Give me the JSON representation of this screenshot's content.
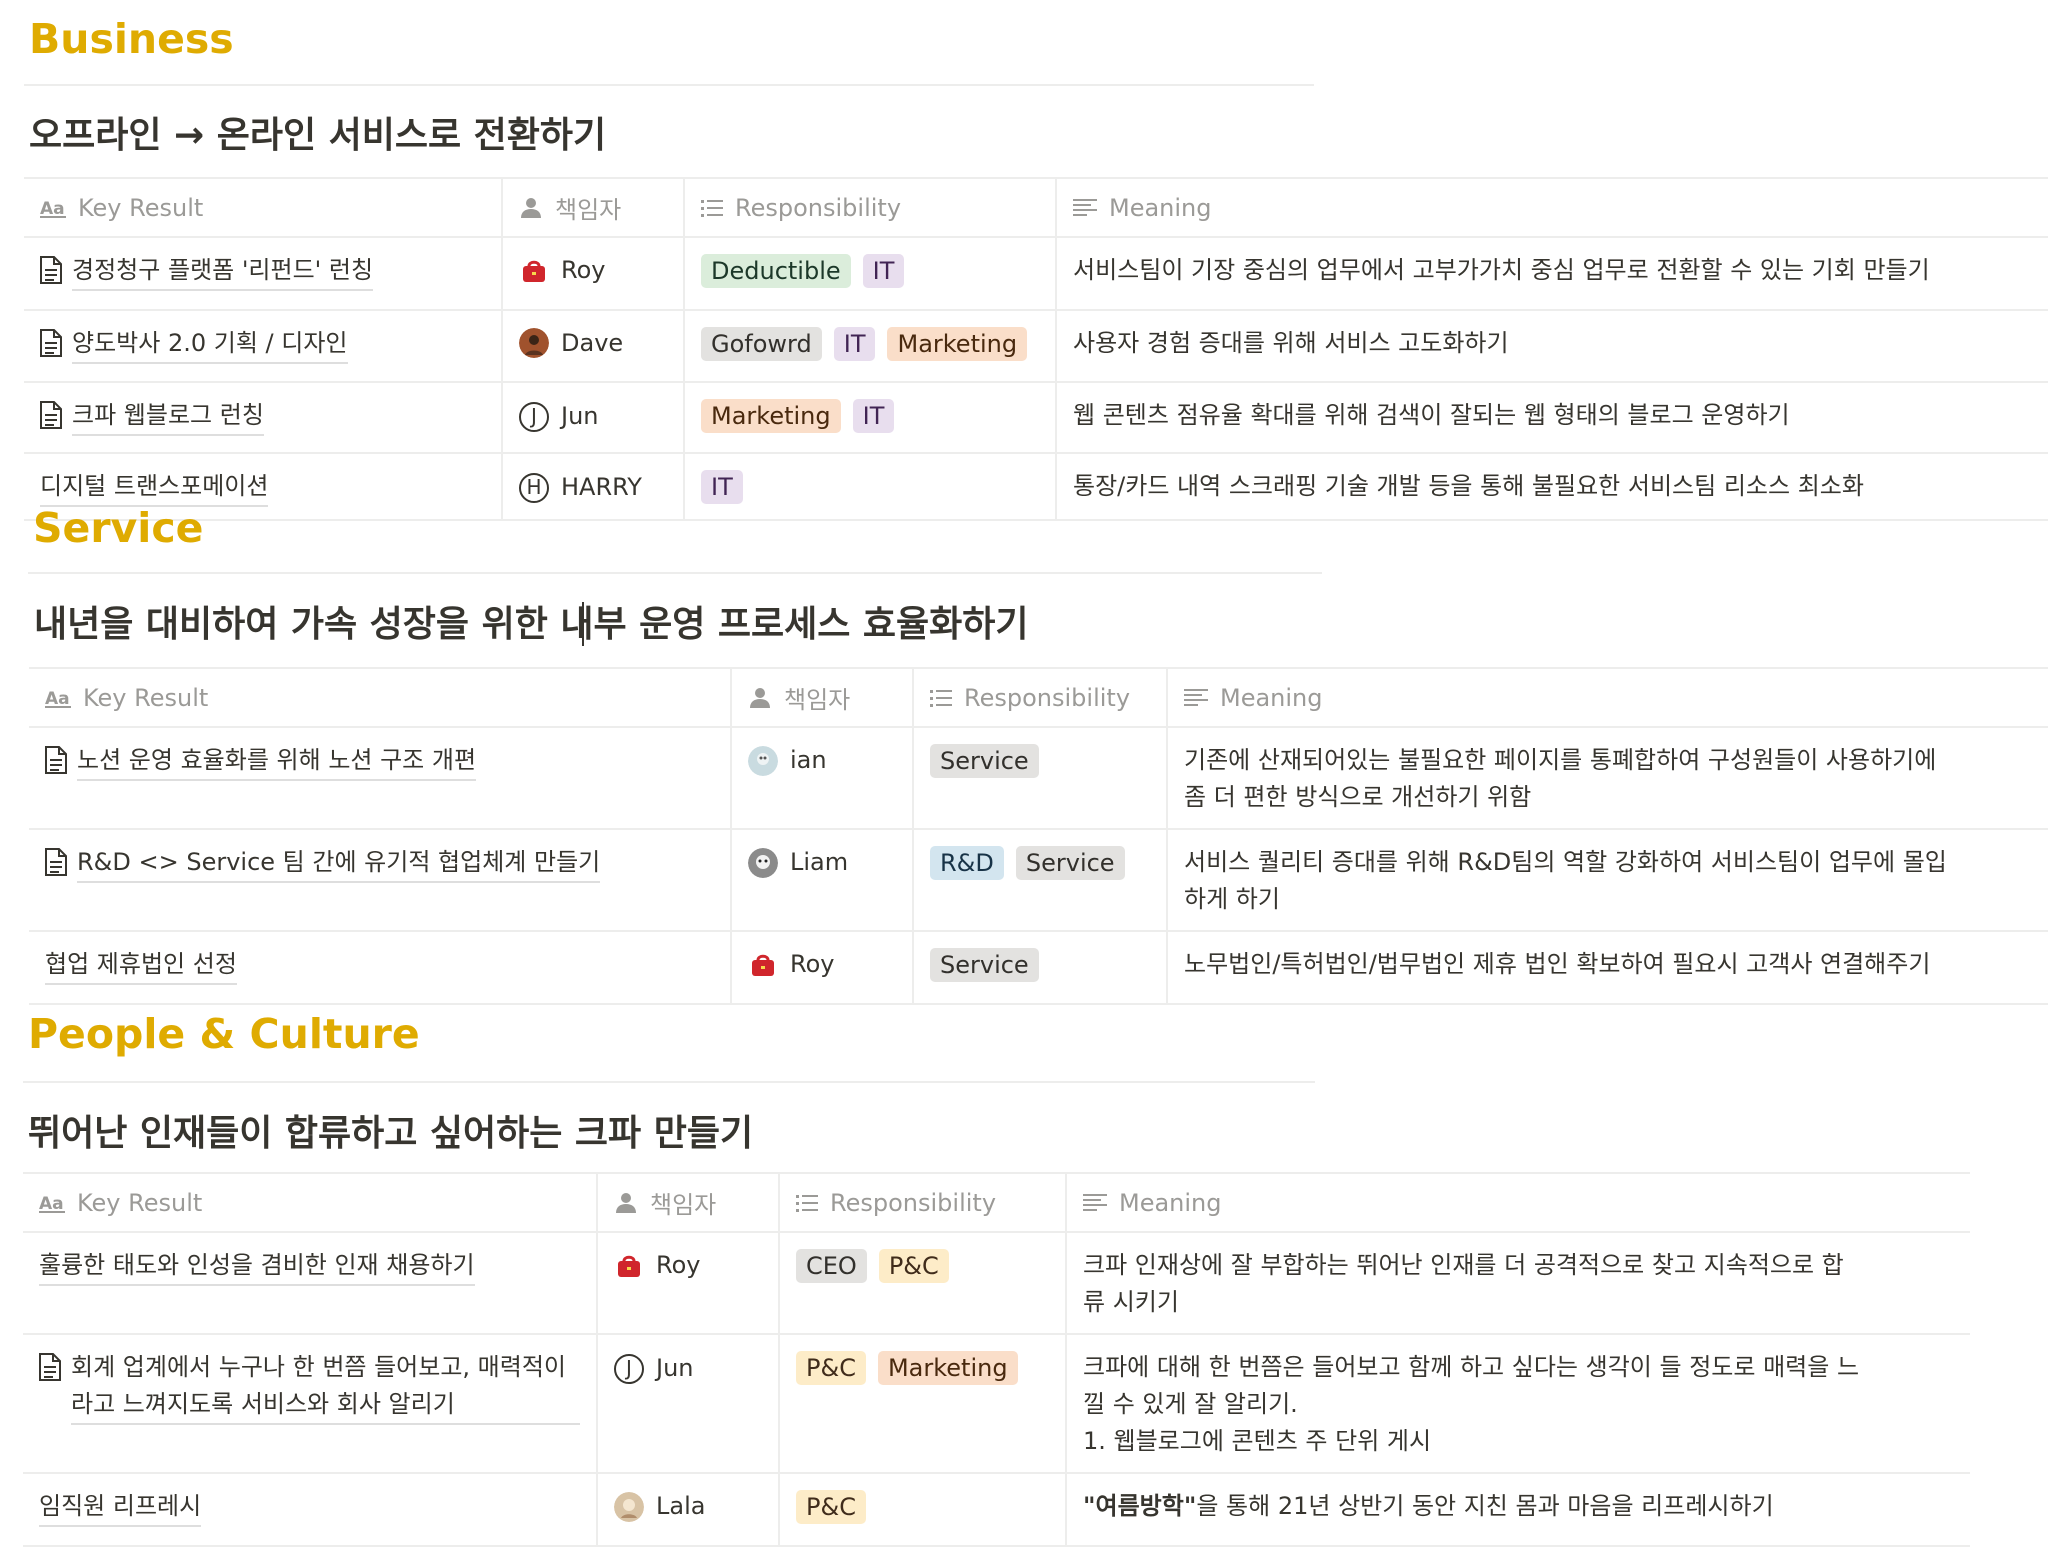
{
  "sections": [
    {
      "title": "Business",
      "objective": "오프라인 → 온라인 서비스로 전환하기",
      "columns": {
        "key_result": "Key Result",
        "owner": "책임자",
        "responsibility": "Responsibility",
        "meaning": "Meaning"
      },
      "rows": [
        {
          "key_result": "경정청구 플랫폼 '리펀드' 런칭",
          "page_icon": true,
          "owner": "Roy",
          "avatar": "red-bag-avatar",
          "tags": [
            "Deductible",
            "IT"
          ],
          "meaning": [
            "서비스팀이 기장 중심의 업무에서 고부가가치 중심 업무로 전환할 수 있는 기회 만들기"
          ]
        },
        {
          "key_result": "양도박사 2.0 기획 / 디자인",
          "page_icon": true,
          "owner": "Dave",
          "avatar": "photo-avatar-dave",
          "tags": [
            "Gofowrd",
            "IT",
            "Marketing"
          ],
          "meaning": [
            "사용자 경험 증대를 위해 서비스 고도화하기"
          ]
        },
        {
          "key_result": "크파 웹블로그 런칭",
          "page_icon": true,
          "owner": "Jun",
          "avatar": "J",
          "tags": [
            "Marketing",
            "IT"
          ],
          "meaning": [
            "웹 콘텐츠 점유율 확대를 위해 검색이 잘되는 웹 형태의 블로그 운영하기"
          ]
        },
        {
          "key_result": "디지털 트랜스포메이션",
          "page_icon": false,
          "owner": "HARRY",
          "avatar": "H",
          "tags": [
            "IT"
          ],
          "meaning": [
            "통장/카드 내역 스크래핑 기술 개발 등을 통해 불필요한 서비스팀 리소스 최소화"
          ]
        }
      ]
    },
    {
      "title": "Service",
      "objective": "내년을 대비하여 가속 성장을 위한 내부 운영 프로세스 효율화하기",
      "columns": {
        "key_result": "Key Result",
        "owner": "책임자",
        "responsibility": "Responsibility",
        "meaning": "Meaning"
      },
      "rows": [
        {
          "key_result": "노션 운영 효율화를 위해 노션 구조 개편",
          "page_icon": true,
          "owner": "ian",
          "avatar": "photo-avatar-ian",
          "tags": [
            "Service"
          ],
          "meaning": [
            "기존에 산재되어있는 불필요한 페이지를 통폐합하여 구성원들이 사용하기에",
            "좀 더 편한 방식으로 개선하기 위함"
          ]
        },
        {
          "key_result": "R&D <> Service 팀 간에 유기적 협업체계 만들기",
          "page_icon": true,
          "owner": "Liam",
          "avatar": "photo-avatar-liam",
          "tags": [
            "R&D",
            "Service"
          ],
          "meaning": [
            "서비스 퀄리티 증대를 위해 R&D팀의 역할 강화하여 서비스팀이 업무에 몰입",
            "하게 하기"
          ]
        },
        {
          "key_result": "협업 제휴법인 선정",
          "page_icon": false,
          "owner": "Roy",
          "avatar": "red-bag-avatar",
          "tags": [
            "Service"
          ],
          "meaning": [
            "노무법인/특허법인/법무법인 제휴 법인 확보하여 필요시 고객사 연결해주기"
          ]
        }
      ]
    },
    {
      "title": "People & Culture",
      "objective": "뛰어난 인재들이 합류하고 싶어하는 크파 만들기",
      "columns": {
        "key_result": "Key Result",
        "owner": "책임자",
        "responsibility": "Responsibility",
        "meaning": "Meaning"
      },
      "rows": [
        {
          "key_result": "훌륭한 태도와 인성을 겸비한 인재 채용하기",
          "page_icon": false,
          "owner": "Roy",
          "avatar": "red-bag-avatar",
          "tags": [
            "CEO",
            "P&C"
          ],
          "meaning": [
            "크파 인재상에 잘 부합하는 뛰어난 인재를 더 공격적으로 찾고 지속적으로 합",
            "류 시키기"
          ]
        },
        {
          "key_result": "회계 업계에서 누구나 한 번쯤 들어보고, 매력적이라고 느껴지도록 서비스와 회사 알리기",
          "page_icon": true,
          "owner": "Jun",
          "avatar": "J",
          "tags": [
            "P&C",
            "Marketing"
          ],
          "meaning": [
            "크파에 대해 한 번쯤은 들어보고 함께 하고 싶다는 생각이 들 정도로 매력을 느",
            "낄 수 있게 잘 알리기.",
            "1. 웹블로그에 콘텐츠 주 단위 게시"
          ]
        },
        {
          "key_result": "임직원 리프레시",
          "page_icon": false,
          "owner": "Lala",
          "avatar": "photo-avatar-lala",
          "tags": [
            "P&C"
          ],
          "meaning_bold": "\"여름방학\"",
          "meaning": [
            "을 통해 21년 상반기 동안 지친 몸과 마음을 리프레시하기"
          ]
        }
      ]
    }
  ],
  "colors": {
    "section_title": "#dfab01",
    "text": "#37352f",
    "header_text": "#9b9a97",
    "border": "#ededec"
  },
  "icons": {
    "key_result_header": "text-aa-icon",
    "owner_header": "person-icon",
    "responsibility_header": "list-icon",
    "meaning_header": "lines-icon",
    "page": "page-icon"
  }
}
